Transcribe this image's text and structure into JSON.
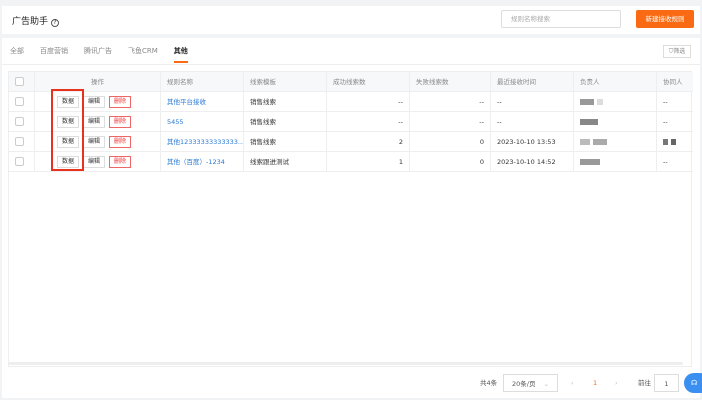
{
  "header": {
    "title": "广告助手",
    "search_placeholder": "规则名称搜索",
    "new_button": "新建接收规则"
  },
  "tabs": [
    "全部",
    "百度营销",
    "腾讯广告",
    "飞鱼CRM",
    "其他"
  ],
  "active_tab": "其他",
  "filter_label": "筛选",
  "columns": [
    "操作",
    "规则名称",
    "线索模板",
    "成功线索数",
    "失败线索数",
    "最近接收时间",
    "负责人",
    "协同人"
  ],
  "actions": {
    "data": "数据",
    "edit": "编辑",
    "delete": "删除"
  },
  "rows": [
    {
      "name": "其他平台接收",
      "template": "销售线索",
      "success": "--",
      "fail": "--",
      "time": "--",
      "collab": "--"
    },
    {
      "name": "5455",
      "template": "销售线索",
      "success": "--",
      "fail": "--",
      "time": "--",
      "collab": "--"
    },
    {
      "name": "其他12333333333333...",
      "template": "销售线索",
      "success": "2",
      "fail": "0",
      "time": "2023-10-10 13:53",
      "collab": ""
    },
    {
      "name": "其他（百度）-1234",
      "template": "线索跟进测试",
      "success": "1",
      "fail": "0",
      "time": "2023-10-10 14:52",
      "collab": "--"
    }
  ],
  "pagination": {
    "total": "共4条",
    "page_size": "20条/页",
    "prev": "‹",
    "current": "1",
    "next": "›",
    "goto_label": "前往",
    "goto_value": "1"
  },
  "colors": {
    "accent": "#f96a12",
    "highlight": "#e8321e",
    "link": "#2a7ad6"
  }
}
